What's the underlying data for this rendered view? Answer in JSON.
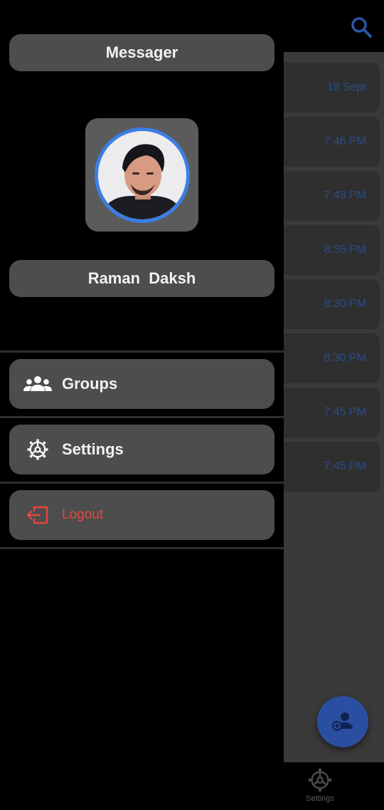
{
  "drawer": {
    "title": "Messager",
    "user_name": "Raman  Daksh",
    "menu": [
      {
        "label": "Groups",
        "icon": "groups-icon"
      },
      {
        "label": "Settings",
        "icon": "gear-icon"
      },
      {
        "label": "Logout",
        "icon": "logout-icon"
      }
    ]
  },
  "chats": {
    "times": [
      "18 Sept",
      "7:46 PM",
      "7:43 PM",
      "8:35 PM",
      "8:30 PM",
      "8:30 PM",
      "7:45 PM",
      "7:45 PM"
    ]
  },
  "bottom_nav": {
    "settings_label": "Settings"
  },
  "colors": {
    "accent": "#3b7ee6",
    "logout": "#e5473f",
    "pill": "#4d4d4d"
  }
}
